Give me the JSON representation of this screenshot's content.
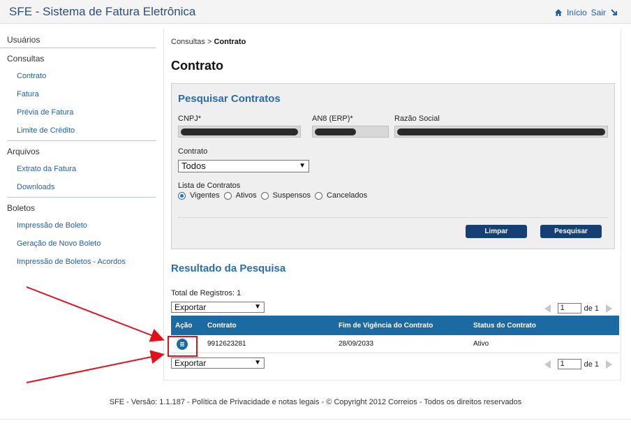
{
  "header": {
    "app_title": "SFE - Sistema de Fatura Eletrônica",
    "home_label": "Início",
    "exit_label": "Sair"
  },
  "sidebar": {
    "sections": [
      {
        "label": "Usuários",
        "items": []
      },
      {
        "label": "Consultas",
        "items": [
          "Contrato",
          "Fatura",
          "Prévia de Fatura",
          "Limite de Crédito"
        ]
      },
      {
        "label": "Arquivos",
        "items": [
          "Extrato da Fatura",
          "Downloads"
        ]
      },
      {
        "label": "Boletos",
        "items": [
          "Impressão de Boleto",
          "Geração de Novo Boleto",
          "Impressão de Boletos - Acordos"
        ]
      }
    ]
  },
  "breadcrumb": {
    "parent": "Consultas >",
    "current": "Contrato"
  },
  "page_title": "Contrato",
  "search": {
    "title": "Pesquisar Contratos",
    "cnpj_label": "CNPJ*",
    "an8_label": "AN8 (ERP)*",
    "razao_label": "Razão Social",
    "contrato_label": "Contrato",
    "contrato_value": "Todos",
    "lista_label": "Lista de Contratos",
    "radios": [
      {
        "label": "Vigentes",
        "checked": true
      },
      {
        "label": "Ativos",
        "checked": false
      },
      {
        "label": "Suspensos",
        "checked": false
      },
      {
        "label": "Cancelados",
        "checked": false
      }
    ],
    "clear_button": "Limpar",
    "search_button": "Pesquisar"
  },
  "results": {
    "title": "Resultado da Pesquisa",
    "total_label": "Total de Registros: 1",
    "export_label": "Exportar",
    "pager": {
      "page": "1",
      "of_label": "de 1"
    },
    "columns": [
      "Ação",
      "Contrato",
      "Fim de Vigência do Contrato",
      "Status do Contrato"
    ],
    "rows": [
      {
        "contrato": "9912623281",
        "fim_vigencia": "28/09/2033",
        "status": "Ativo"
      }
    ]
  },
  "footer": {
    "text": "SFE - Versão: 1.1.187 - Política de Privacidade e notas legais - © Copyright 2012 Correios - Todos os direitos reservados"
  },
  "colors": {
    "accent": "#1b6aa2",
    "button": "#163f73",
    "annotation": "#e3101c",
    "link": "#1f5fb0"
  }
}
